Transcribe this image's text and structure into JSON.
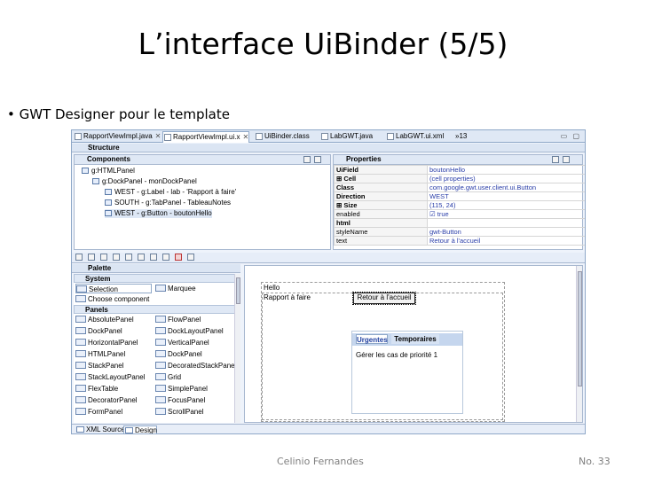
{
  "slide": {
    "title": "L’interface UiBinder (5/5)",
    "bullet": "• GWT Designer pour le template",
    "author": "Celinio Fernandes",
    "page": "No. 33"
  },
  "editor_tabs": [
    {
      "label": "RapportViewImpl.java",
      "close": "✕",
      "active": false
    },
    {
      "label": "RapportViewImpl.ui.x",
      "close": "✕",
      "active": true
    },
    {
      "label": "UiBinder.class",
      "close": "",
      "active": false
    },
    {
      "label": "LabGWT.java",
      "close": "",
      "active": false
    },
    {
      "label": "LabGWT.ui.xml",
      "close": "",
      "active": false
    },
    {
      "label": "»13",
      "close": "",
      "active": false
    }
  ],
  "structure": {
    "title": "Structure",
    "components_title": "Components",
    "tree": [
      {
        "label": "g:HTMLPanel"
      },
      {
        "label": "g:DockPanel - monDockPanel"
      },
      {
        "label": "WEST - g:Label - lab - 'Rapport à faire'"
      },
      {
        "label": "SOUTH - g:TabPanel - TableauNotes"
      },
      {
        "label": "WEST - g:Button - boutonHello"
      }
    ],
    "properties_title": "Properties",
    "properties": [
      {
        "name": "UiField",
        "value": "boutonHello"
      },
      {
        "name": "⊞ Cell",
        "value": "(cell properties)"
      },
      {
        "name": "Class",
        "value": "com.google.gwt.user.client.ui.Button"
      },
      {
        "name": "Direction",
        "value": "WEST"
      },
      {
        "name": "⊞ Size",
        "value": "(115, 24)"
      },
      {
        "name": "enabled",
        "value": "☑ true"
      },
      {
        "name": "html",
        "value": ""
      },
      {
        "name": "styleName",
        "value": "gwt-Button"
      },
      {
        "name": "text",
        "value": "Retour à l'accueil"
      }
    ]
  },
  "palette": {
    "title": "Palette",
    "system_cat": "System",
    "selection": "Selection",
    "marquee": "Marquee",
    "choose": "Choose component",
    "panels_cat": "Panels",
    "left_items": [
      "AbsolutePanel",
      "DockPanel",
      "HorizontalPanel",
      "HTMLPanel",
      "StackPanel",
      "StackLayoutPanel",
      "FlexTable",
      "DecoratorPanel",
      "FormPanel"
    ],
    "right_items": [
      "FlowPanel",
      "DockLayoutPanel",
      "VerticalPanel",
      "DockPanel",
      "DecoratedStackPanel",
      "Grid",
      "SimplePanel",
      "FocusPanel",
      "ScrollPanel"
    ]
  },
  "canvas": {
    "hello": "Hello",
    "rapport": "Rapport à faire",
    "button": "Retour à l'accueil",
    "tabs": [
      "Urgentes",
      "Temporaires"
    ],
    "tab_content": "Gérer les cas de priorité 1"
  },
  "bottom_tabs": [
    {
      "label": "XML Source",
      "active": false
    },
    {
      "label": "Design",
      "active": true
    }
  ],
  "colors": {
    "frame_border": "#8fa8c8",
    "header_bg": "#dfe8f5",
    "value_text": "#2a3ea8",
    "tabbar_bg": "#c5d6ee"
  }
}
